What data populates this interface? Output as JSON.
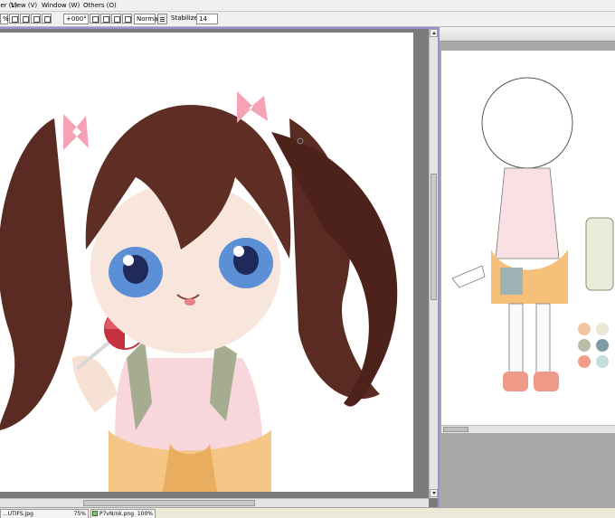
{
  "menu": {
    "items": [
      "Layer (L)",
      "View (V)",
      "Window (W)",
      "Others (O)"
    ]
  },
  "toolbar": {
    "zoom_value": "%",
    "rotation_value": "+000°",
    "blend_mode": "Normal",
    "stabilizer_label": "Stabilizer",
    "stabilizer_value": "14"
  },
  "status": {
    "tabs": [
      {
        "label": "...UTIFS.jpg",
        "zoom": "75%"
      },
      {
        "label": "P7vN/nk.png",
        "zoom": "100%"
      }
    ]
  },
  "colors": {
    "selection_border": "#9a8fd0",
    "swatches": [
      "#f2c4a4",
      "#ece6d6",
      "#b8bda8",
      "#7f9ca6",
      "#ee9e88",
      "#c5dfe1"
    ]
  },
  "icons": [
    "button-icon",
    "hamburger-icon",
    "up-arrow-icon",
    "down-arrow-icon"
  ]
}
